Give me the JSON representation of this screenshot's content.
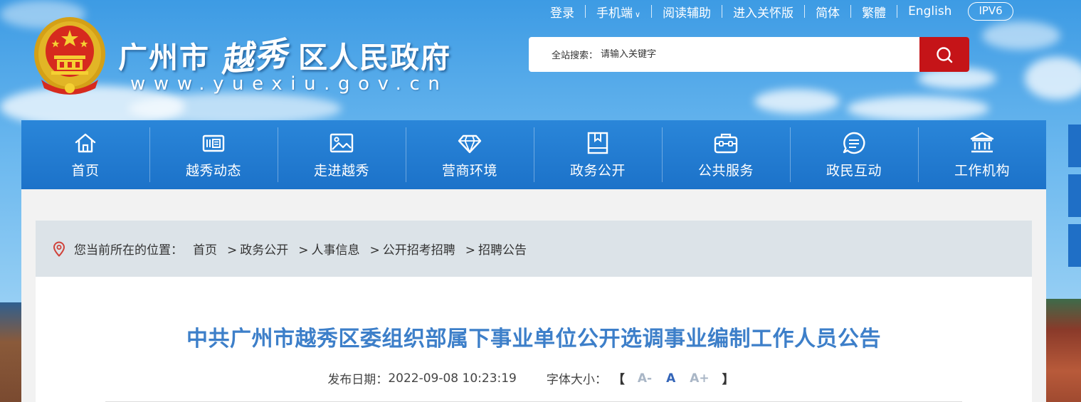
{
  "header": {
    "top_links": [
      {
        "label": "登录",
        "has_arrow": false
      },
      {
        "label": "手机端",
        "has_arrow": true
      },
      {
        "label": "阅读辅助",
        "has_arrow": false
      },
      {
        "label": "进入关怀版",
        "has_arrow": false
      },
      {
        "label": "简体",
        "has_arrow": false
      },
      {
        "label": "繁體",
        "has_arrow": false
      },
      {
        "label": "English",
        "has_arrow": false
      }
    ],
    "ipv6_badge": "IPV6",
    "title_prefix": "广州市",
    "title_calligraphy": "越秀",
    "title_suffix": "区人民政府",
    "site_url": "www.yuexiu.gov.cn"
  },
  "search": {
    "label": "全站搜索：",
    "placeholder": "请输入关键字",
    "button_icon": "search-icon",
    "button_color": "#c51418"
  },
  "nav": {
    "items": [
      {
        "label": "首页",
        "icon": "home-icon"
      },
      {
        "label": "越秀动态",
        "icon": "newspaper-icon"
      },
      {
        "label": "走进越秀",
        "icon": "picture-icon"
      },
      {
        "label": "营商环境",
        "icon": "diamond-icon"
      },
      {
        "label": "政务公开",
        "icon": "document-icon"
      },
      {
        "label": "公共服务",
        "icon": "briefcase-icon"
      },
      {
        "label": "政民互动",
        "icon": "chat-icon"
      },
      {
        "label": "工作机构",
        "icon": "institution-icon"
      }
    ],
    "background_color": "#1c72c9"
  },
  "breadcrumb": {
    "prefix": "您当前所在的位置：",
    "items": [
      "首页",
      "政务公开",
      "人事信息",
      "公开招考招聘",
      "招聘公告"
    ]
  },
  "article": {
    "title": "中共广州市越秀区委组织部属下事业单位公开选调事业编制工作人员公告",
    "publish_label": "发布日期：",
    "publish_date": "2022-09-08 10:23:19",
    "font_size_label": "字体大小：",
    "bracket_open": "【",
    "bracket_close": "】",
    "font_sizes": [
      "A-",
      "A",
      "A+"
    ],
    "font_size_active": "A",
    "title_color": "#3d7fc9"
  }
}
